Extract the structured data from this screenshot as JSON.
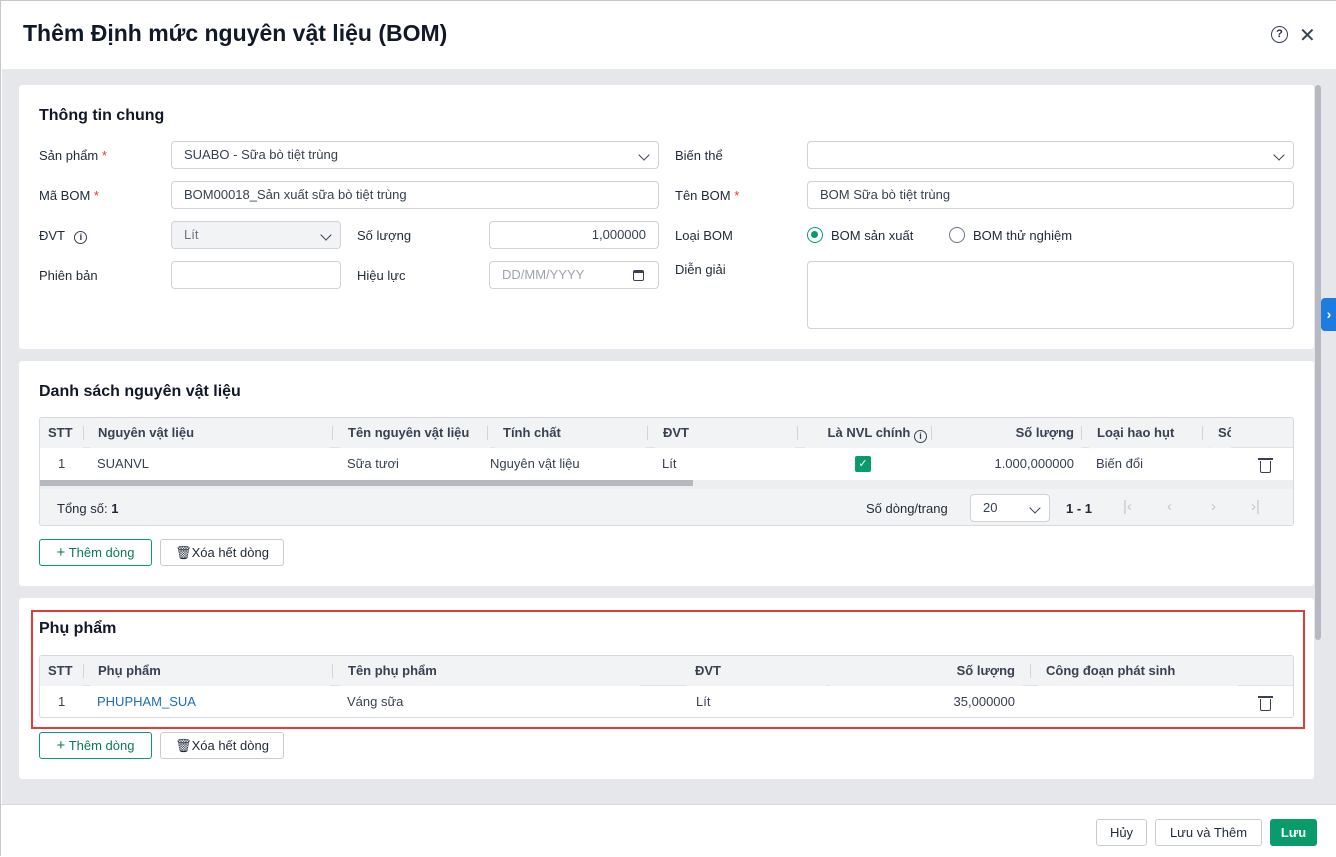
{
  "dialog": {
    "title": "Thêm Định mức nguyên vật liệu (BOM)"
  },
  "general": {
    "title": "Thông tin chung",
    "product_label": "Sản phẩm",
    "product_value": "SUABO - Sữa bò tiệt trùng",
    "variant_label": "Biến thể",
    "variant_value": "",
    "bom_code_label": "Mã BOM",
    "bom_code_value": "BOM00018_Sản xuất sữa bò tiệt trùng",
    "bom_name_label": "Tên BOM",
    "bom_name_value": "BOM Sữa bò tiệt trùng",
    "unit_label": "ĐVT",
    "unit_value": "Lít",
    "qty_label": "Số lượng",
    "qty_value": "1,000000",
    "bom_type_label": "Loại BOM",
    "bom_type_options": [
      "BOM sản xuất",
      "BOM thử nghiệm"
    ],
    "bom_type_selected": "BOM sản xuất",
    "version_label": "Phiên bản",
    "version_value": "",
    "effective_label": "Hiệu lực",
    "effective_placeholder": "DD/MM/YYYY",
    "desc_label": "Diễn giải",
    "desc_value": "",
    "required_mark": "*"
  },
  "materials": {
    "title": "Danh sách nguyên vật liệu",
    "columns": [
      "STT",
      "Nguyên vật liệu",
      "Tên nguyên vật liệu",
      "Tính chất",
      "ĐVT",
      "Là NVL chính",
      "Số lượng",
      "Loại hao hụt",
      "Số"
    ],
    "rows": [
      {
        "stt": "1",
        "code": "SUANVL",
        "name": "Sữa tươi",
        "type": "Nguyên vật liệu",
        "unit": "Lít",
        "main": true,
        "qty": "1.000,000000",
        "loss": "Biến đổi"
      }
    ],
    "total_label": "Tổng số:",
    "total_value": "1",
    "page_size_label": "Số dòng/trang",
    "page_size": "20",
    "range": "1 - 1",
    "add_label": "Thêm dòng",
    "clear_label": "Xóa hết dòng"
  },
  "byproducts": {
    "title": "Phụ phẩm",
    "columns": [
      "STT",
      "Phụ phẩm",
      "Tên phụ phẩm",
      "ĐVT",
      "Số lượng",
      "Công đoạn phát sinh"
    ],
    "rows": [
      {
        "stt": "1",
        "code": "PHUPHAM_SUA",
        "name": "Váng sữa",
        "unit": "Lít",
        "qty": "35,000000",
        "stage": ""
      }
    ],
    "add_label": "Thêm dòng",
    "clear_label": "Xóa hết dòng"
  },
  "footer": {
    "cancel": "Hủy",
    "save_add": "Lưu và Thêm",
    "save": "Lưu"
  },
  "colors": {
    "primary": "#0a9b6a",
    "highlight": "#e03c3c",
    "side_tab": "#1e7be0"
  }
}
